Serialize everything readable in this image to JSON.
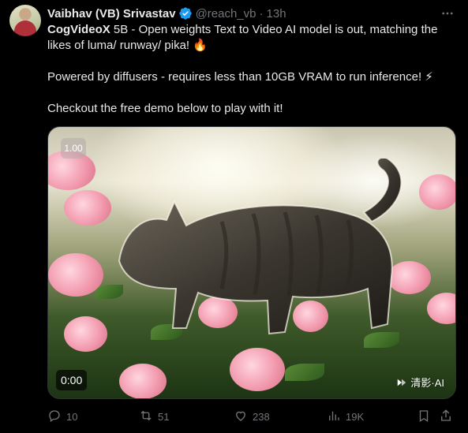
{
  "author": {
    "name": "Vaibhav (VB) Srivastav",
    "handle": "@reach_vb",
    "separator": "·",
    "time": "13h"
  },
  "body": {
    "line1_bold": "CogVideoX",
    "line1_rest": " 5B - Open weights Text to Video AI model is out, matching the likes of luma/ runway/ pika! 🔥",
    "line2": "Powered by diffusers - requires less than 10GB VRAM to run inference! ⚡",
    "line3": "Checkout the free demo below to play with it!"
  },
  "media": {
    "speed": "1.00",
    "timestamp": "0:00",
    "watermark": "清影·AI"
  },
  "actions": {
    "replies": "10",
    "reposts": "51",
    "likes": "238",
    "views": "19K"
  },
  "colors": {
    "verified": "#1d9bf0",
    "muted": "#71767b",
    "text": "#e7e9ea",
    "background": "#000000"
  },
  "icons": [
    "more-icon",
    "verified-icon",
    "reply-icon",
    "repost-icon",
    "like-icon",
    "views-icon",
    "bookmark-icon",
    "share-icon"
  ]
}
